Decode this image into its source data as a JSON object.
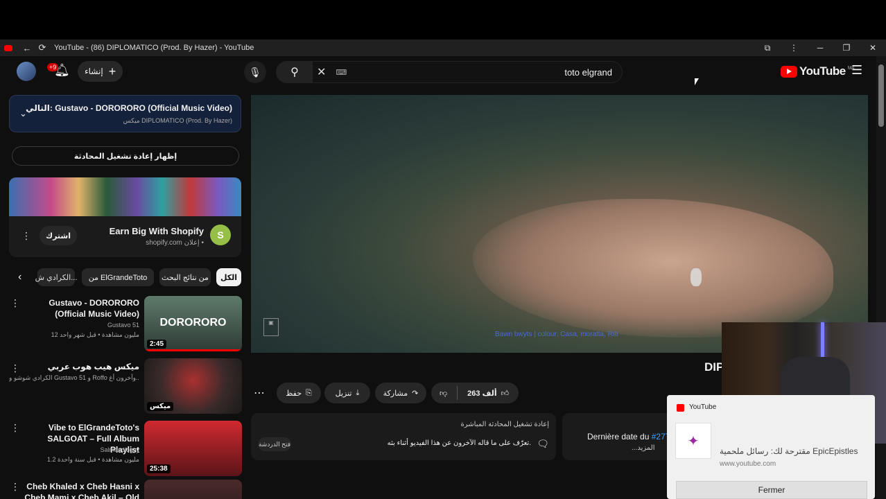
{
  "window": {
    "title": "YouTube - (86) DIPLOMATICO (Prod. By Hazer) - YouTube",
    "controls": {
      "minimize": "─",
      "restore": "❐",
      "close": "✕"
    }
  },
  "header": {
    "notifications_badge": "+9",
    "create_label": "إنشاء",
    "search_query": "toto elgrand",
    "logo_text": "YouTube",
    "logo_region": "MA"
  },
  "sidebar": {
    "up_next": {
      "label": "التالي:",
      "title": "Gustavo - DORORORO (Official Music Video)",
      "subtitle": "ميكس DIPLOMATICO (Prod. By Hazer)"
    },
    "show_chat_label": "إظهار إعادة تشغيل المحادثة",
    "ad": {
      "title": "Earn Big With Shopify",
      "domain": "shopify.com",
      "ad_label": "إعلان •",
      "subscribe_label": "اشترك"
    },
    "chips": [
      "الكل",
      "من نتائج البحث",
      "من ElGrandeToto",
      "الكرادي ش..."
    ],
    "videos": [
      {
        "title": "Gustavo - DORORORO (Official Music Video)",
        "channel": "Gustavo 51",
        "meta": "12 مليون مشاهدة • قبل شهر واحد",
        "duration": "2:45",
        "thumb_text": "DORORORO",
        "color": "#4b6a5a"
      },
      {
        "title": "ميكس هيب هوب عربي",
        "channel": "",
        "meta": "الكرادي شوشو و Gustavo 51 و Roffo وآخرون أغ...",
        "duration": "ميكس",
        "thumb_text": "",
        "color": "#7a1f22"
      },
      {
        "title": "Vibe to ElGrandeToto's SALGOAT – Full Album Playlist",
        "channel": "Salmanologyy",
        "meta": "1.2 مليون مشاهدة • قبل سنة واحدة",
        "duration": "25:38",
        "thumb_text": "",
        "color": "#b3202a"
      },
      {
        "title": "Cheb Khaled x Cheb Hasni x Cheb Mami x Cheb Akil – Old",
        "channel": "",
        "meta": "",
        "duration": "",
        "thumb_text": "",
        "color": "#3a2a2a"
      }
    ]
  },
  "player": {
    "caption": "Bawn bwyts | colour: Casa, moratta, Ritt",
    "title_partial": "DIP"
  },
  "actions": {
    "likes": "263 ألف",
    "share": "مشاركة",
    "download": "تنزيل",
    "save": "حفظ",
    "more": "..."
  },
  "chat_box": {
    "title": "إعادة تشغيل المحادثة المباشرة",
    "desc": "تعرّف على ما قاله الآخرون عن هذا الفيديو أثناء بثه.",
    "open_label": "فتح الدردشة"
  },
  "desc_box": {
    "text": "Dernière date du",
    "hashtag": "#27T",
    "more": "...المزيد"
  },
  "popup": {
    "source": "YouTube",
    "title": "مقترحة لك: رسائل ملحمية EpicEpistles",
    "url": "www.youtube.com",
    "button": "Fermer"
  }
}
